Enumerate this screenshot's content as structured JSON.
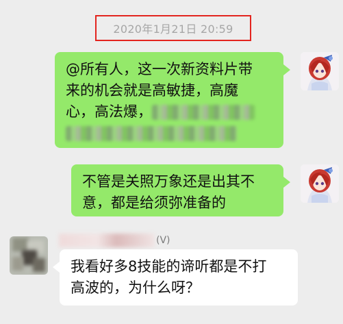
{
  "timestamp": "2020年1月21日 20:59",
  "messages": [
    {
      "sender": "self",
      "avatar": "anime-avatar-icon",
      "lines": [
        "@所有人，这一次新资料片带",
        "来的机会就是高敏捷，高魔",
        "心，高法爆，"
      ]
    },
    {
      "sender": "self",
      "avatar": "anime-avatar-icon",
      "lines": [
        "不管是关照万象还是出其不",
        "意，都是给须弥准备的"
      ]
    },
    {
      "sender": "other",
      "sender_name_suffix": "(V)",
      "avatar": "blurred-avatar-icon",
      "lines": [
        "我看好多8技能的谛听都是不打",
        "高波的，为什么呀？"
      ]
    }
  ],
  "colors": {
    "chat_background": "#ededed",
    "self_bubble": "#94e96a",
    "other_bubble": "#ffffff",
    "highlight_border": "#e3241e",
    "timestamp_text": "#a6a6a6"
  }
}
